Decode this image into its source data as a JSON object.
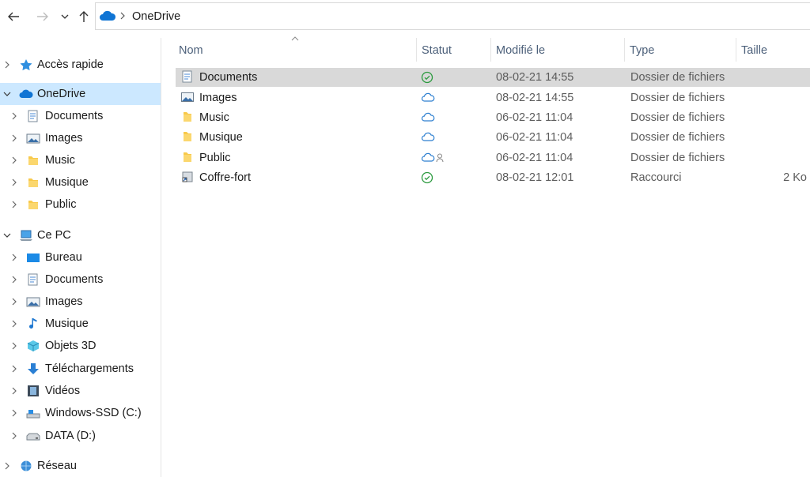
{
  "address": {
    "crumb": "OneDrive"
  },
  "sidebar": {
    "items": [
      {
        "label": "Accès rapide",
        "icon": "star-icon"
      },
      {
        "label": "OneDrive",
        "icon": "cloud-icon"
      },
      {
        "label": "Documents",
        "icon": "document-folder-icon"
      },
      {
        "label": "Images",
        "icon": "images-folder-icon"
      },
      {
        "label": "Music",
        "icon": "folder-icon"
      },
      {
        "label": "Musique",
        "icon": "folder-icon"
      },
      {
        "label": "Public",
        "icon": "folder-icon"
      },
      {
        "label": "Ce PC",
        "icon": "computer-icon"
      },
      {
        "label": "Bureau",
        "icon": "desktop-icon"
      },
      {
        "label": "Documents",
        "icon": "document-folder-icon"
      },
      {
        "label": "Images",
        "icon": "images-folder-icon"
      },
      {
        "label": "Musique",
        "icon": "music-note-icon"
      },
      {
        "label": "Objets 3D",
        "icon": "cube-icon"
      },
      {
        "label": "Téléchargements",
        "icon": "download-arrow-icon"
      },
      {
        "label": "Vidéos",
        "icon": "film-icon"
      },
      {
        "label": "Windows-SSD (C:)",
        "icon": "drive-icon"
      },
      {
        "label": "DATA (D:)",
        "icon": "drive-icon"
      },
      {
        "label": "Réseau",
        "icon": "network-icon"
      }
    ]
  },
  "columns": {
    "name": "Nom",
    "status": "Statut",
    "modified": "Modifié le",
    "type": "Type",
    "size": "Taille"
  },
  "files": [
    {
      "name": "Documents",
      "status": "synced",
      "modified": "08-02-21 14:55",
      "type": "Dossier de fichiers",
      "size": ""
    },
    {
      "name": "Images",
      "status": "cloud",
      "modified": "08-02-21 14:55",
      "type": "Dossier de fichiers",
      "size": ""
    },
    {
      "name": "Music",
      "status": "cloud",
      "modified": "06-02-21 11:04",
      "type": "Dossier de fichiers",
      "size": ""
    },
    {
      "name": "Musique",
      "status": "cloud",
      "modified": "06-02-21 11:04",
      "type": "Dossier de fichiers",
      "size": ""
    },
    {
      "name": "Public",
      "status": "cloud-shared",
      "modified": "06-02-21 11:04",
      "type": "Dossier de fichiers",
      "size": ""
    },
    {
      "name": "Coffre-fort",
      "status": "synced",
      "modified": "08-02-21 12:01",
      "type": "Raccourci",
      "size": "2 Ko"
    }
  ],
  "colors": {
    "accent": "#0078d4",
    "selection": "#cce8ff",
    "row_selected": "#d9d9d9",
    "synced_green": "#2b9a3e",
    "folder_yellow": "#f8c94a"
  }
}
